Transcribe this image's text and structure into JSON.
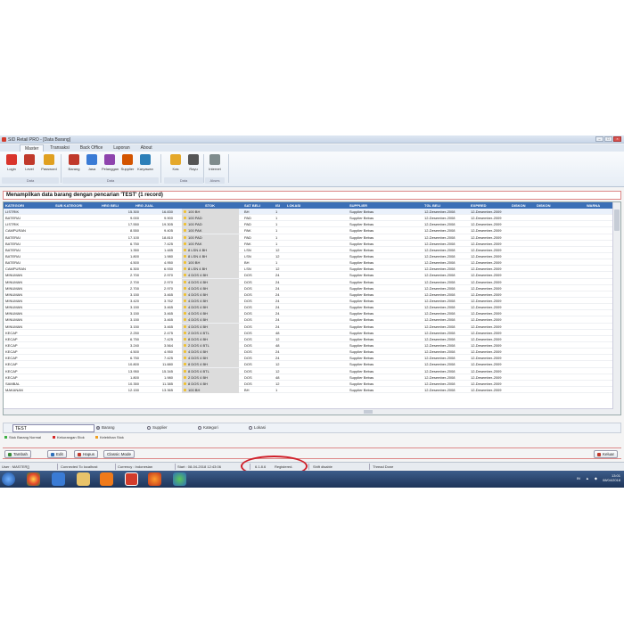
{
  "window": {
    "title": "SID Retail PRO - [Data Barang]"
  },
  "tabs": [
    "Master",
    "Transaksi",
    "Back Office",
    "Laporan",
    "About"
  ],
  "ribbon": {
    "buttons": [
      {
        "label": "Login",
        "icon": "login-icon",
        "color": "#d9342b"
      },
      {
        "label": "Level",
        "icon": "level-icon",
        "color": "#c0392b"
      },
      {
        "label": "Password",
        "icon": "password-icon",
        "color": "#e0a020"
      },
      {
        "label": "Barang",
        "icon": "barang-icon",
        "color": "#c0392b"
      },
      {
        "label": "Jasa",
        "icon": "jasa-icon",
        "color": "#3a7bd5"
      },
      {
        "label": "Pelanggan",
        "icon": "pelanggan-icon",
        "color": "#8e44ad"
      },
      {
        "label": "Supplier",
        "icon": "supplier-icon",
        "color": "#d35400"
      },
      {
        "label": "Karyawan",
        "icon": "karyawan-icon",
        "color": "#2c7fb8"
      },
      {
        "label": "Kas",
        "icon": "kas-icon",
        "color": "#e5a82a"
      },
      {
        "label": "Rayu",
        "icon": "rayu-icon",
        "color": "#555555"
      },
      {
        "label": "Internet",
        "icon": "internet-icon",
        "color": "#7f8c8d"
      }
    ],
    "groups": [
      "Data",
      "Data",
      "Data",
      "Akses"
    ]
  },
  "content_title": "Menampilkan data barang dengan pencarian 'TEST' (1 record)",
  "table": {
    "columns": [
      "KATEGORI",
      "SUB KATEGORI",
      "HRG BELI",
      "HRG JUAL",
      "STOK",
      "SAT BELI",
      "ISI",
      "LOKASI",
      "SUPPLIER",
      "TGL BELI",
      "EXPIRED",
      "DISKON",
      "DISKON",
      "WARNA"
    ],
    "rows": [
      [
        "LISTRIK",
        "",
        "15.300",
        "16.830",
        "100 BH",
        "BH",
        "1",
        "",
        "Supplier Bebas",
        "12-Desember-2008",
        "12-Desember-2009"
      ],
      [
        "BATERAI",
        "",
        "9.000",
        "9.900",
        "100 PAD",
        "PAD",
        "1",
        "",
        "Supplier Bebas",
        "12-Desember-2008",
        "12-Desember-2009"
      ],
      [
        "LISTRIK",
        "",
        "17.550",
        "19.305",
        "100 PAD",
        "PAD",
        "1",
        "",
        "Supplier Bebas",
        "12-Desember-2008",
        "12-Desember-2009"
      ],
      [
        "CAMPURAN",
        "",
        "8.550",
        "9.405",
        "100 PAK",
        "PAK",
        "1",
        "",
        "Supplier Bebas",
        "12-Desember-2008",
        "12-Desember-2009"
      ],
      [
        "BATERAI",
        "",
        "17.100",
        "18.810",
        "100 PAD",
        "PAD",
        "1",
        "",
        "Supplier Bebas",
        "12-Desember-2008",
        "12-Desember-2009"
      ],
      [
        "BATERAI",
        "",
        "6.750",
        "7.425",
        "100 PAK",
        "PAK",
        "1",
        "",
        "Supplier Bebas",
        "12-Desember-2008",
        "12-Desember-2009"
      ],
      [
        "BATERAI",
        "",
        "1.350",
        "1.485",
        "8 LSN 4 BH",
        "LSN",
        "12",
        "",
        "Supplier Bebas",
        "12-Desember-2008",
        "12-Desember-2009"
      ],
      [
        "BATERAI",
        "",
        "1.800",
        "1.980",
        "8 LSN 4 BH",
        "LSN",
        "12",
        "",
        "Supplier Bebas",
        "12-Desember-2008",
        "12-Desember-2009"
      ],
      [
        "BATERAI",
        "",
        "4.500",
        "4.950",
        "100 BH",
        "BH",
        "1",
        "",
        "Supplier Bebas",
        "12-Desember-2008",
        "12-Desember-2009"
      ],
      [
        "CAMPURAN",
        "",
        "6.300",
        "6.930",
        "8 LSN 4 BH",
        "LSN",
        "12",
        "",
        "Supplier Bebas",
        "12-Desember-2008",
        "12-Desember-2009"
      ],
      [
        "MINUMAN",
        "",
        "2.700",
        "2.970",
        "4 DOS 4 BH",
        "DOS",
        "24",
        "",
        "Supplier Bebas",
        "12-Desember-2008",
        "12-Desember-2009"
      ],
      [
        "MINUMAN",
        "",
        "2.700",
        "2.970",
        "4 DOS 4 BH",
        "DOS",
        "24",
        "",
        "Supplier Bebas",
        "12-Desember-2008",
        "12-Desember-2009"
      ],
      [
        "MINUMAN",
        "",
        "2.700",
        "2.970",
        "4 DOS 4 BH",
        "DOS",
        "24",
        "",
        "Supplier Bebas",
        "12-Desember-2008",
        "12-Desember-2009"
      ],
      [
        "MINUMAN",
        "",
        "3.150",
        "3.465",
        "4 DOS 4 BH",
        "DOS",
        "24",
        "",
        "Supplier Bebas",
        "12-Desember-2008",
        "12-Desember-2009"
      ],
      [
        "MINUMAN",
        "",
        "3.420",
        "3.762",
        "4 DOS 4 BH",
        "DOS",
        "24",
        "",
        "Supplier Bebas",
        "12-Desember-2008",
        "12-Desember-2009"
      ],
      [
        "MINUMAN",
        "",
        "3.150",
        "3.465",
        "4 DOS 4 BH",
        "DOS",
        "24",
        "",
        "Supplier Bebas",
        "12-Desember-2008",
        "12-Desember-2009"
      ],
      [
        "MINUMAN",
        "",
        "3.150",
        "3.465",
        "4 DOS 4 BH",
        "DOS",
        "24",
        "",
        "Supplier Bebas",
        "12-Desember-2008",
        "12-Desember-2009"
      ],
      [
        "MINUMAN",
        "",
        "3.150",
        "3.465",
        "4 DOS 4 BH",
        "DOS",
        "24",
        "",
        "Supplier Bebas",
        "12-Desember-2008",
        "12-Desember-2009"
      ],
      [
        "MINUMAN",
        "",
        "3.150",
        "3.465",
        "4 DOS 4 BH",
        "DOS",
        "24",
        "",
        "Supplier Bebas",
        "12-Desember-2008",
        "12-Desember-2009"
      ],
      [
        "KECAP",
        "",
        "2.250",
        "2.475",
        "2 DOS 4 BTL",
        "DOS",
        "48",
        "",
        "Supplier Bebas",
        "12-Desember-2008",
        "12-Desember-2009"
      ],
      [
        "KECAP",
        "",
        "6.750",
        "7.425",
        "8 DOS 4 BH",
        "DOS",
        "12",
        "",
        "Supplier Bebas",
        "12-Desember-2008",
        "12-Desember-2009"
      ],
      [
        "KECAP",
        "",
        "3.240",
        "3.564",
        "2 DOS 4 BTL",
        "DOS",
        "48",
        "",
        "Supplier Bebas",
        "12-Desember-2008",
        "12-Desember-2009"
      ],
      [
        "KECAP",
        "",
        "4.500",
        "4.950",
        "4 DOS 4 BH",
        "DOS",
        "24",
        "",
        "Supplier Bebas",
        "12-Desember-2008",
        "12-Desember-2009"
      ],
      [
        "KECAP",
        "",
        "6.750",
        "7.425",
        "4 DOS 4 BH",
        "DOS",
        "24",
        "",
        "Supplier Bebas",
        "12-Desember-2008",
        "12-Desember-2009"
      ],
      [
        "KECAP",
        "",
        "10.800",
        "11.880",
        "8 DOS 4 BH",
        "DOS",
        "12",
        "",
        "Supplier Bebas",
        "12-Desember-2008",
        "12-Desember-2009"
      ],
      [
        "KECAP",
        "",
        "13.950",
        "15.345",
        "8 DOS 4 BTL",
        "DOS",
        "12",
        "",
        "Supplier Bebas",
        "12-Desember-2008",
        "12-Desember-2009"
      ],
      [
        "KECAP",
        "",
        "1.800",
        "1.980",
        "2 DOS 4 BH",
        "DOS",
        "48",
        "",
        "Supplier Bebas",
        "12-Desember-2008",
        "12-Desember-2009"
      ],
      [
        "SAMBAL",
        "",
        "10.350",
        "11.385",
        "8 DOS 4 BH",
        "DOS",
        "12",
        "",
        "Supplier Bebas",
        "12-Desember-2008",
        "12-Desember-2009"
      ],
      [
        "MAKANAN",
        "",
        "12.150",
        "13.365",
        "100 BH",
        "BH",
        "1",
        "",
        "Supplier Bebas",
        "12-Desember-2008",
        "12-Desember-2009"
      ]
    ]
  },
  "search": {
    "value": "TEST",
    "options": [
      {
        "label": "Barang",
        "selected": true
      },
      {
        "label": "Supplier",
        "selected": false
      },
      {
        "label": "Kategori",
        "selected": false
      },
      {
        "label": "Lokasi",
        "selected": false
      }
    ]
  },
  "legend": [
    {
      "label": "Stok Barang Normal",
      "color": "#3cb043"
    },
    {
      "label": "Kekurangan Stok",
      "color": "#d62828"
    },
    {
      "label": "Kelebihan Stok",
      "color": "#f0a020"
    }
  ],
  "actions": {
    "tambah": "Tambah",
    "edit": "Edit",
    "hapus": "Hapus",
    "classic": "Classic Mode",
    "keluar": "Keluar"
  },
  "status": {
    "user": "User : MASTER[]",
    "connected": "Connected To localhost",
    "currency": "Currency : Indonesian",
    "start": "Start : 08-04-2018 12:43:06",
    "version": "6.1.8.6",
    "registered": "Registered.",
    "shift": "Shift disable",
    "thread": "Thread Done"
  },
  "taskbar": {
    "time": "13:01",
    "date": "08/04/2018",
    "lang": "IN"
  }
}
